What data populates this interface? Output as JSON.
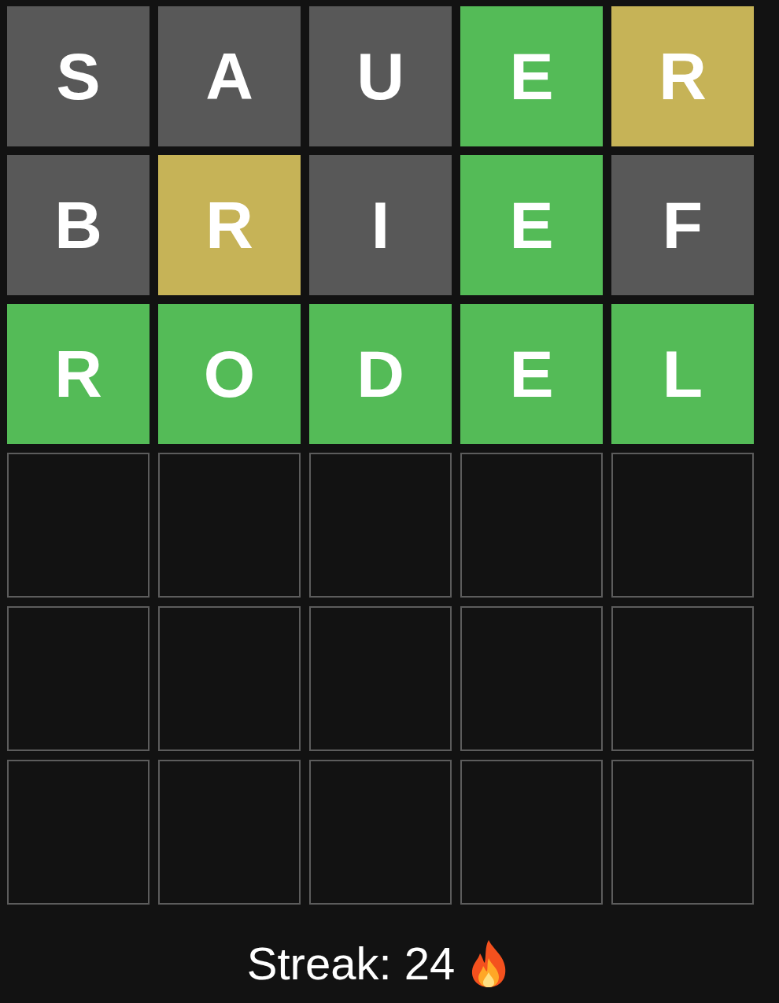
{
  "board": {
    "rows": [
      {
        "tiles": [
          {
            "kind": "letter",
            "letter": "S",
            "color": "#585858"
          },
          {
            "kind": "letter",
            "letter": "A",
            "color": "#585858"
          },
          {
            "kind": "letter",
            "letter": "U",
            "color": "#585858"
          },
          {
            "kind": "letter",
            "letter": "E",
            "color": "#54bb57"
          },
          {
            "kind": "letter",
            "letter": "R",
            "color": "#c6b357"
          }
        ]
      },
      {
        "tiles": [
          {
            "kind": "letter",
            "letter": "B",
            "color": "#585858"
          },
          {
            "kind": "letter",
            "letter": "R",
            "color": "#c6b357"
          },
          {
            "kind": "letter",
            "letter": "I",
            "color": "#585858"
          },
          {
            "kind": "letter",
            "letter": "E",
            "color": "#54bb57"
          },
          {
            "kind": "letter",
            "letter": "F",
            "color": "#585858"
          }
        ]
      },
      {
        "tiles": [
          {
            "kind": "letter",
            "letter": "R",
            "color": "#54bb57"
          },
          {
            "kind": "letter",
            "letter": "O",
            "color": "#54bb57"
          },
          {
            "kind": "letter",
            "letter": "D",
            "color": "#54bb57"
          },
          {
            "kind": "letter",
            "letter": "E",
            "color": "#54bb57"
          },
          {
            "kind": "letter",
            "letter": "L",
            "color": "#54bb57"
          }
        ]
      },
      {
        "tiles": [
          {
            "kind": "empty"
          },
          {
            "kind": "empty"
          },
          {
            "kind": "empty"
          },
          {
            "kind": "empty"
          },
          {
            "kind": "empty"
          }
        ]
      },
      {
        "tiles": [
          {
            "kind": "empty"
          },
          {
            "kind": "empty"
          },
          {
            "kind": "empty"
          },
          {
            "kind": "empty"
          },
          {
            "kind": "empty"
          }
        ]
      },
      {
        "tiles": [
          {
            "kind": "empty"
          },
          {
            "kind": "empty"
          },
          {
            "kind": "empty"
          },
          {
            "kind": "empty"
          },
          {
            "kind": "empty"
          }
        ]
      }
    ]
  },
  "streak": {
    "label": "Streak: 24"
  }
}
